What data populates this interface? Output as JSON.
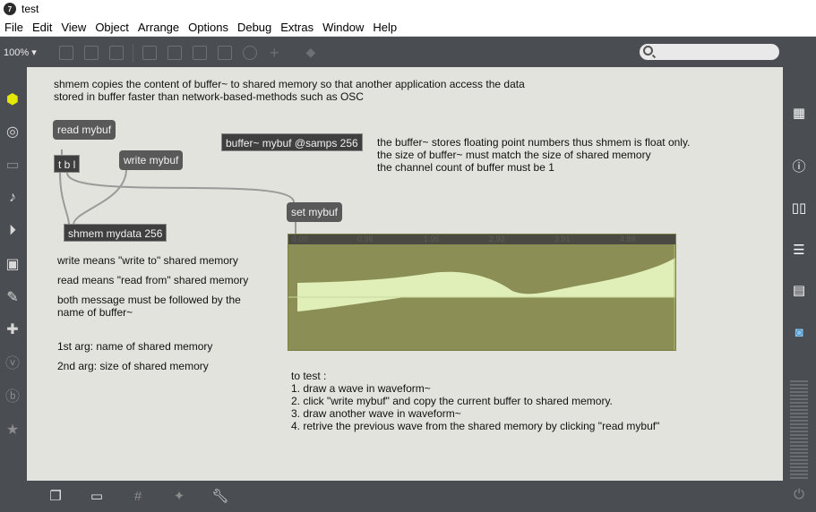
{
  "window": {
    "title": "test",
    "app_icon_letter": "7"
  },
  "menu": [
    "File",
    "Edit",
    "View",
    "Object",
    "Arrange",
    "Options",
    "Debug",
    "Extras",
    "Window",
    "Help"
  ],
  "toolbar": {
    "zoom": "100% ▾"
  },
  "comments": {
    "intro": "shmem copies the content of buffer~ to shared memory so that another application access the data\nstored in buffer faster than network-based-methods such as OSC",
    "buffer_note": "the buffer~ stores floating point numbers thus shmem is float only.\nthe size of buffer~ must match the size of shared memory\nthe channel count of buffer must be 1",
    "write_means": "write means \"write to\" shared memory",
    "read_means": "read means \"read from\" shared memory",
    "both_msg": "both message must be followed by the\nname of buffer~",
    "arg1": "1st arg: name of shared memory",
    "arg2": "2nd arg: size of shared memory",
    "to_test": "to test :\n1. draw a wave in waveform~\n2. click \"write mybuf\" and copy the current buffer to shared memory.\n3. draw another wave in waveform~\n4. retrive the previous wave from the shared memory by clicking \"read mybuf\""
  },
  "messages": {
    "read_mybuf": "read mybuf",
    "write_mybuf": "write mybuf",
    "set_mybuf": "set mybuf"
  },
  "objects": {
    "tbl": "t b l",
    "shmem": "shmem mydata 256",
    "buffer": "buffer~ mybuf @samps 256"
  },
  "waveform": {
    "ruler_labels": [
      "0.00",
      "0.98",
      "1.95",
      "2.93",
      "3.91",
      "4.88"
    ],
    "colors": {
      "background": "#8c8f55",
      "wave_fill": "#e0eeb8",
      "ruler": "#4a4a42"
    }
  },
  "colors": {
    "canvas": "#e3e3dd",
    "chrome": "#4a4d52",
    "message_box": "#595959",
    "object_box": "#3f3f3f"
  }
}
